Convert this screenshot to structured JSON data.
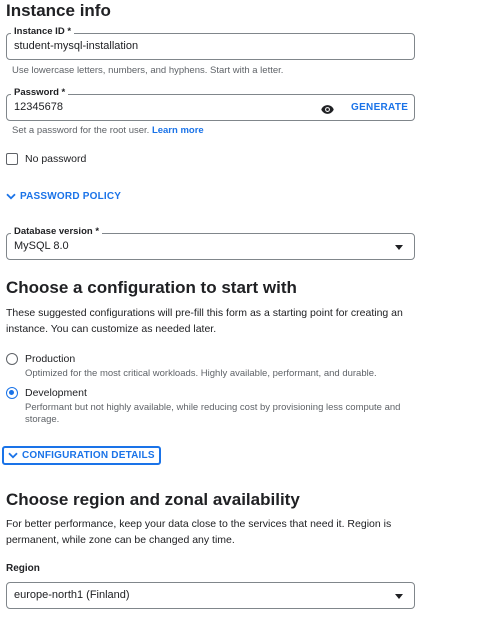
{
  "instance_info": {
    "title": "Instance info",
    "instance_id": {
      "label": "Instance ID *",
      "value": "student-mysql-installation",
      "hint": "Use lowercase letters, numbers, and hyphens. Start with a letter."
    },
    "password": {
      "label": "Password *",
      "value": "12345678",
      "generate_label": "GENERATE",
      "hint": "Set a password for the root user.",
      "learn_more": "Learn more"
    },
    "no_password_label": "No password",
    "password_policy_label": "PASSWORD POLICY",
    "database_version": {
      "label": "Database version *",
      "value": "MySQL 8.0"
    }
  },
  "configuration": {
    "title": "Choose a configuration to start with",
    "description": "These suggested configurations will pre-fill this form as a starting point for creating an instance. You can customize as needed later.",
    "options": [
      {
        "label": "Production",
        "description": "Optimized for the most critical workloads. Highly available, performant, and durable.",
        "selected": false
      },
      {
        "label": "Development",
        "description": "Performant but not highly available, while reducing cost by provisioning less compute and storage.",
        "selected": true
      }
    ],
    "details_label": "CONFIGURATION DETAILS"
  },
  "region": {
    "title": "Choose region and zonal availability",
    "description": "For better performance, keep your data close to the services that need it. Region is permanent, while zone can be changed any time.",
    "label": "Region",
    "value": "europe-north1 (Finland)"
  },
  "colors": {
    "accent": "#1a73e8",
    "text": "#202124",
    "muted": "#5f6368",
    "border": "#80868b"
  }
}
